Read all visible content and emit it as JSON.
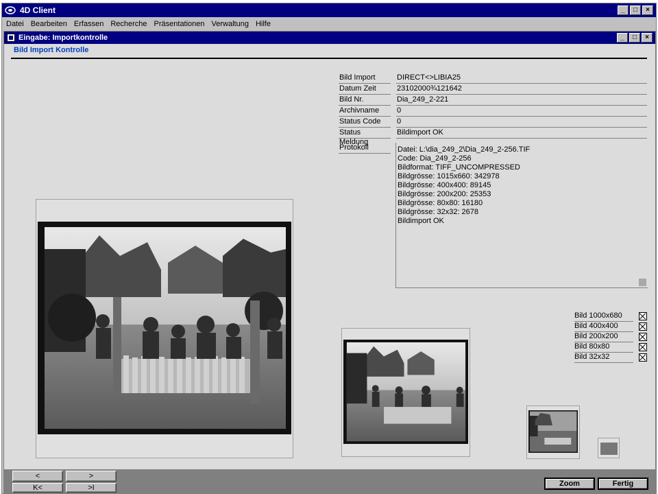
{
  "app": {
    "title": "4D Client"
  },
  "menu": [
    "Datei",
    "Bearbeiten",
    "Erfassen",
    "Recherche",
    "Präsentationen",
    "Verwaltung",
    "Hilfe"
  ],
  "window": {
    "title": "Eingabe: Importkontrolle",
    "subtitle": "Bild Import Kontrolle"
  },
  "fields": [
    {
      "label": "Bild Import",
      "value": "DIRECT<>LIBIA25"
    },
    {
      "label": "Datum Zeit",
      "value": "23102000¾121642"
    },
    {
      "label": "Bild Nr.",
      "value": "Dia_249_2-221"
    },
    {
      "label": "Archivname",
      "value": "0"
    },
    {
      "label": "Status Code",
      "value": "0"
    },
    {
      "label": "Status Meldung",
      "value": "Bildimport OK"
    }
  ],
  "protokoll": {
    "label": "Protokoll",
    "lines": [
      "Datei: L:\\dia_249_2\\Dia_249_2-256.TIF",
      "Code: Dia_249_2-256",
      "Bildformat: TIFF_UNCOMPRESSED",
      "Bildgrösse: 1015x660: 342978",
      "Bildgrösse: 400x400: 89145",
      "Bildgrösse: 200x200: 25353",
      "Bildgrösse: 80x80: 16180",
      "Bildgrösse: 32x32: 2678",
      "Bildimport OK"
    ]
  },
  "sizes": [
    {
      "label": "Bild 1000x680",
      "checked": true
    },
    {
      "label": "Bild 400x400",
      "checked": true
    },
    {
      "label": "Bild 200x200",
      "checked": true
    },
    {
      "label": "Bild 80x80",
      "checked": true
    },
    {
      "label": "Bild 32x32",
      "checked": true
    }
  ],
  "nav": {
    "prev": "<",
    "next": ">",
    "first": "K<",
    "last": ">I"
  },
  "buttons": {
    "zoom": "Zoom",
    "fertig": "Fertig"
  }
}
